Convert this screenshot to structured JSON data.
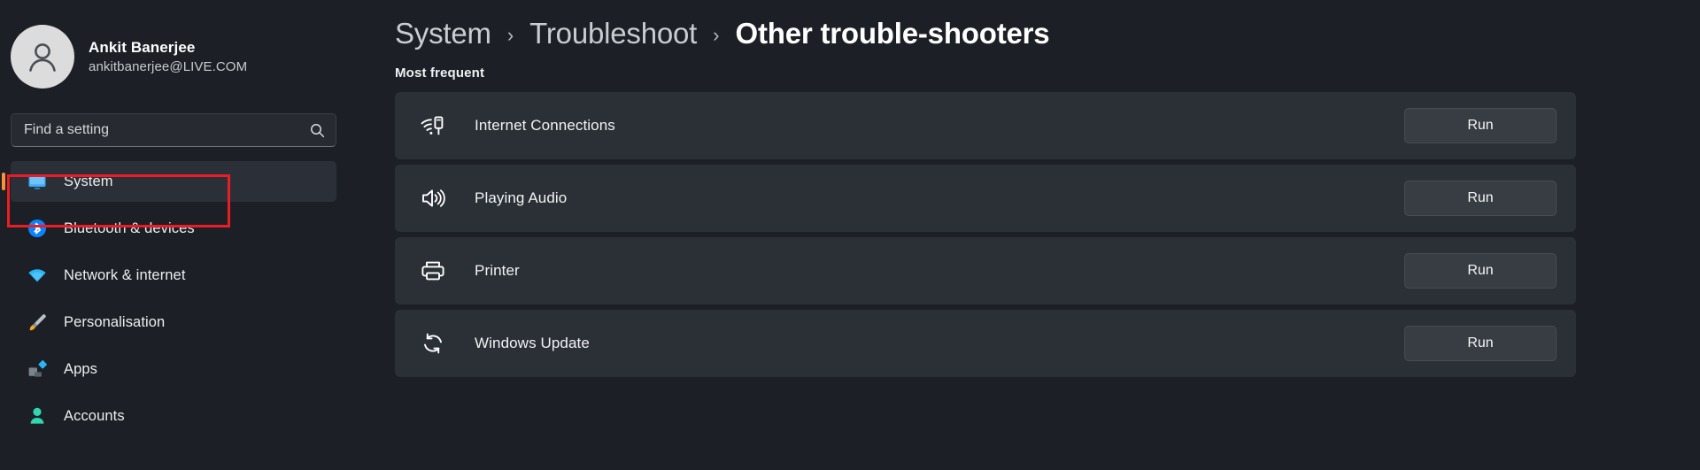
{
  "account": {
    "name": "Ankit Banerjee",
    "email": "ankitbanerjee@LIVE.COM",
    "avatar_icon": "user-avatar-icon"
  },
  "search": {
    "placeholder": "Find a setting",
    "value": "",
    "icon": "search-icon"
  },
  "sidebar": {
    "items": [
      {
        "label": "System",
        "icon": "monitor-icon",
        "selected": true
      },
      {
        "label": "Bluetooth & devices",
        "icon": "bluetooth-icon",
        "selected": false
      },
      {
        "label": "Network & internet",
        "icon": "wifi-icon",
        "selected": false
      },
      {
        "label": "Personalisation",
        "icon": "paintbrush-icon",
        "selected": false
      },
      {
        "label": "Apps",
        "icon": "apps-icon",
        "selected": false
      },
      {
        "label": "Accounts",
        "icon": "person-icon",
        "selected": false
      }
    ]
  },
  "breadcrumb": {
    "separator": "›",
    "items": [
      {
        "label": "System",
        "current": false
      },
      {
        "label": "Troubleshoot",
        "current": false
      },
      {
        "label": "Other trouble-shooters",
        "current": true
      }
    ]
  },
  "main": {
    "section_title": "Most frequent",
    "troubleshooters": [
      {
        "label": "Internet Connections",
        "icon": "internet-connections-icon",
        "action": "Run"
      },
      {
        "label": "Playing Audio",
        "icon": "speaker-icon",
        "action": "Run"
      },
      {
        "label": "Printer",
        "icon": "printer-icon",
        "action": "Run"
      },
      {
        "label": "Windows Update",
        "icon": "refresh-icon",
        "action": "Run"
      }
    ]
  },
  "annotations": {
    "color": "#ec1c24",
    "boxes": [
      {
        "name": "system-sidebar-highlight"
      },
      {
        "name": "printer-run-highlight"
      }
    ]
  },
  "colors": {
    "background": "#1c2026",
    "card": "#2b3036",
    "selected_item": "#2b3038",
    "accent_bar": "#ff8e3c",
    "annotation": "#ec1c24"
  }
}
